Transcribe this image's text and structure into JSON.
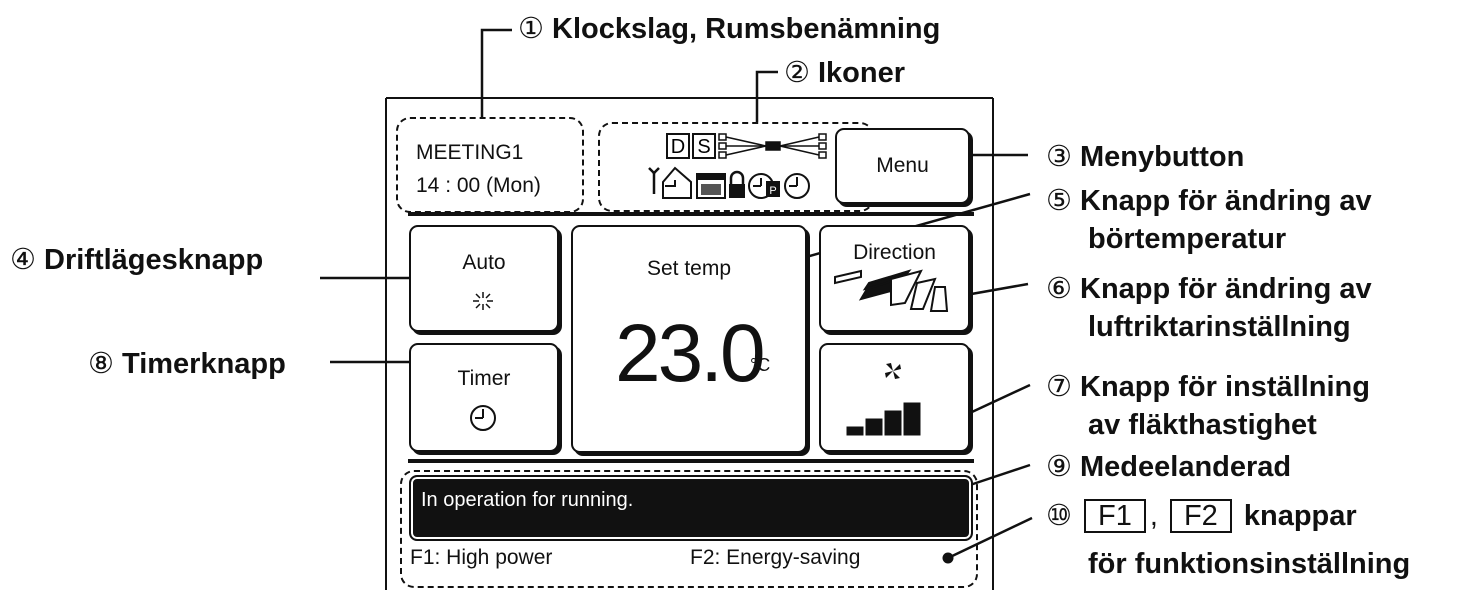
{
  "callouts": {
    "c1": {
      "num": "①",
      "text": "Klockslag, Rumsbenämning"
    },
    "c2": {
      "num": "②",
      "text": "Ikoner"
    },
    "c3": {
      "num": "③",
      "text": "Menybutton"
    },
    "c4": {
      "num": "④",
      "text": "Driftlägesknapp"
    },
    "c5": {
      "num": "⑤",
      "line1": "Knapp för ändring av",
      "line2": "börtemperatur"
    },
    "c6": {
      "num": "⑥",
      "line1": "Knapp för ändring av",
      "line2": "luftriktarinställning"
    },
    "c7": {
      "num": "⑦",
      "line1": "Knapp för inställning",
      "line2": "av fläkthastighet"
    },
    "c8": {
      "num": "⑧",
      "text": "Timerknapp"
    },
    "c9": {
      "num": "⑨",
      "text": "Medeelanderad"
    },
    "c10": {
      "num": "⑩",
      "f1": "F1",
      "sep": ",",
      "f2": "F2",
      "rest": "knappar",
      "line2": "för funktionsinställning"
    }
  },
  "screen": {
    "room_name": "MEETING1",
    "clock": "14 : 00 (Mon)",
    "icons": {
      "d": "D",
      "s": "S",
      "p": "P"
    },
    "menu_label": "Menu",
    "mode": {
      "label": "Auto",
      "icon": "auto-mode-icon"
    },
    "set_temp": {
      "label": "Set temp",
      "value": "23.0",
      "unit": "°C"
    },
    "direction": {
      "label": "Direction",
      "icon": "louver-direction-icon"
    },
    "fan": {
      "icon": "fan-icon",
      "level": 4,
      "max": 4
    },
    "timer": {
      "label": "Timer",
      "icon": "clock-icon"
    },
    "message": "In operation for running.",
    "f1_label": "F1: High power",
    "f2_label": "F2: Energy-saving"
  }
}
